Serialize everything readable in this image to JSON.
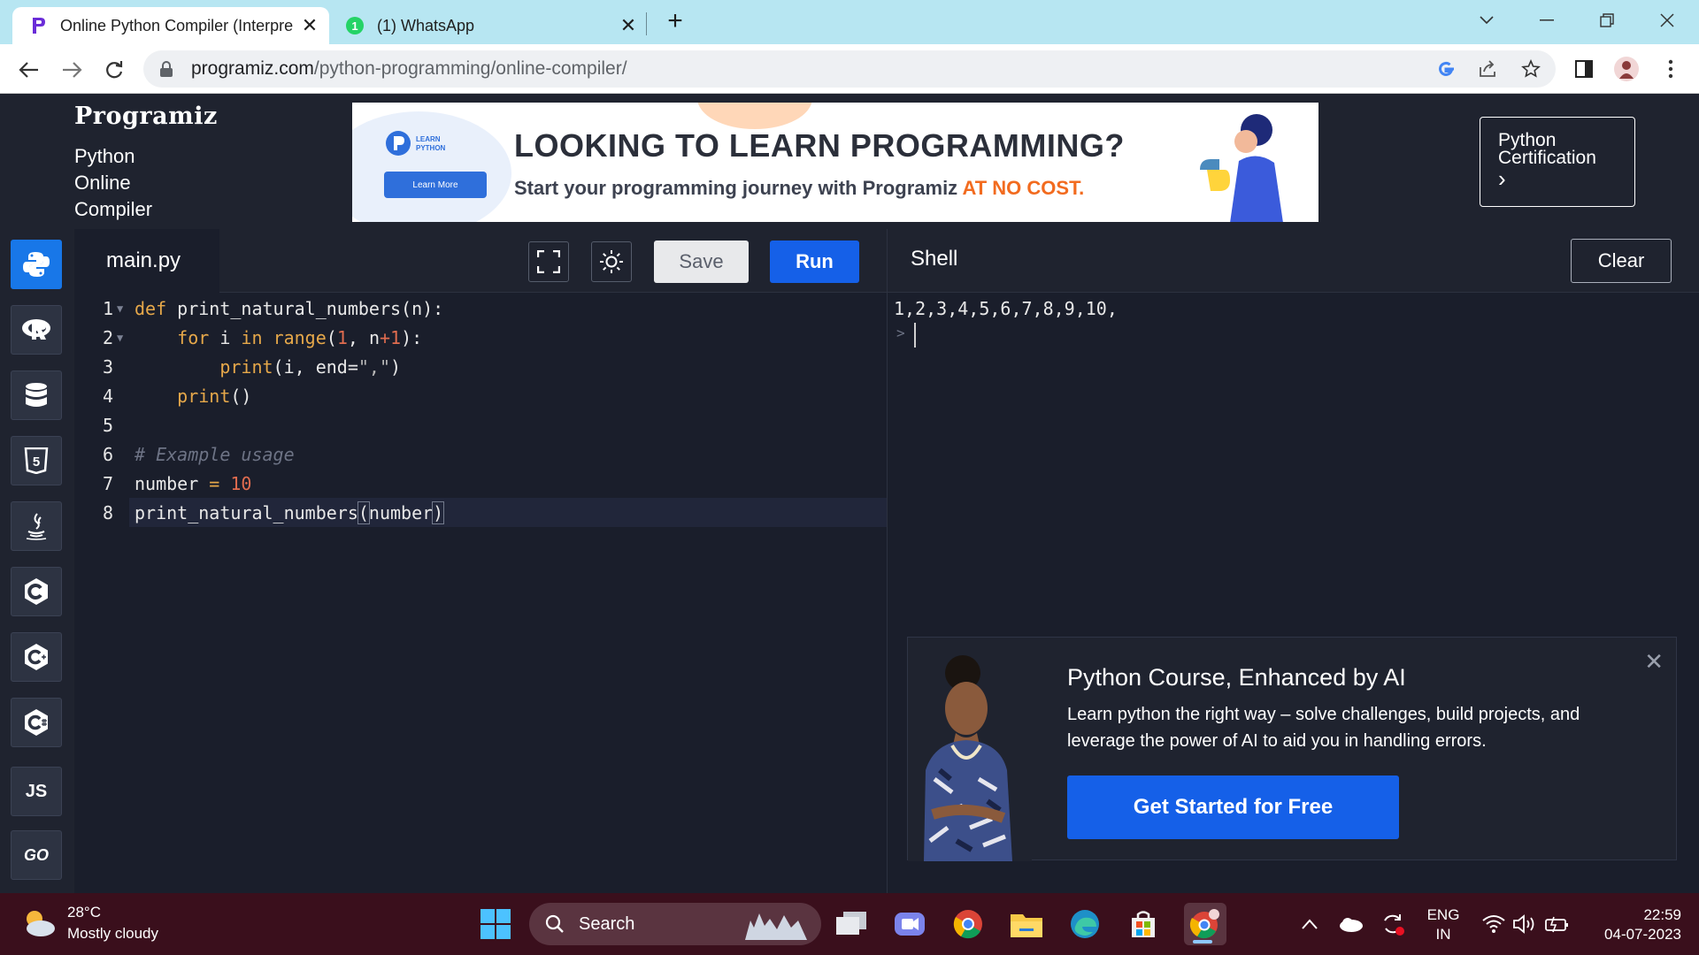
{
  "browser": {
    "tabs": [
      {
        "title": "Online Python Compiler (Interpre",
        "active": true
      },
      {
        "title": "(1) WhatsApp",
        "active": false
      }
    ],
    "url_domain": "programiz.com",
    "url_path": "/python-programming/online-compiler/"
  },
  "header": {
    "logo": "Programiz",
    "subtitle_lines": [
      "Python",
      "Online",
      "Compiler"
    ],
    "banner": {
      "badge_top": "LEARN",
      "badge_bottom": "PYTHON",
      "learn_more": "Learn More",
      "headline": "LOOKING TO LEARN PROGRAMMING?",
      "subline": "Start your programming journey with Programiz ",
      "subline_accent": "AT NO COST."
    },
    "cert_button": {
      "line1": "Python",
      "line2": "Certification",
      "arrow": "›"
    }
  },
  "sidebar": {
    "items": [
      {
        "name": "python",
        "active": true
      },
      {
        "name": "r"
      },
      {
        "name": "sql"
      },
      {
        "name": "html"
      },
      {
        "name": "java"
      },
      {
        "name": "c"
      },
      {
        "name": "cpp"
      },
      {
        "name": "csharp"
      },
      {
        "name": "javascript",
        "label": "JS"
      },
      {
        "name": "go",
        "label": "GO"
      }
    ]
  },
  "editor": {
    "filename": "main.py",
    "save_label": "Save",
    "run_label": "Run",
    "line_numbers": [
      "1",
      "2",
      "3",
      "4",
      "5",
      "6",
      "7",
      "8"
    ]
  },
  "shell": {
    "title": "Shell",
    "clear_label": "Clear",
    "output": "1,2,3,4,5,6,7,8,9,10,",
    "prompt": ">"
  },
  "promo": {
    "title": "Python Course, Enhanced by AI",
    "description": "Learn python the right way – solve challenges, build projects, and leverage the power of AI to aid you in handling errors.",
    "cta": "Get Started for Free"
  },
  "taskbar": {
    "temperature": "28°C",
    "weather": "Mostly cloudy",
    "search_placeholder": "Search",
    "lang_top": "ENG",
    "lang_bottom": "IN",
    "time": "22:59",
    "date": "04-07-2023"
  }
}
